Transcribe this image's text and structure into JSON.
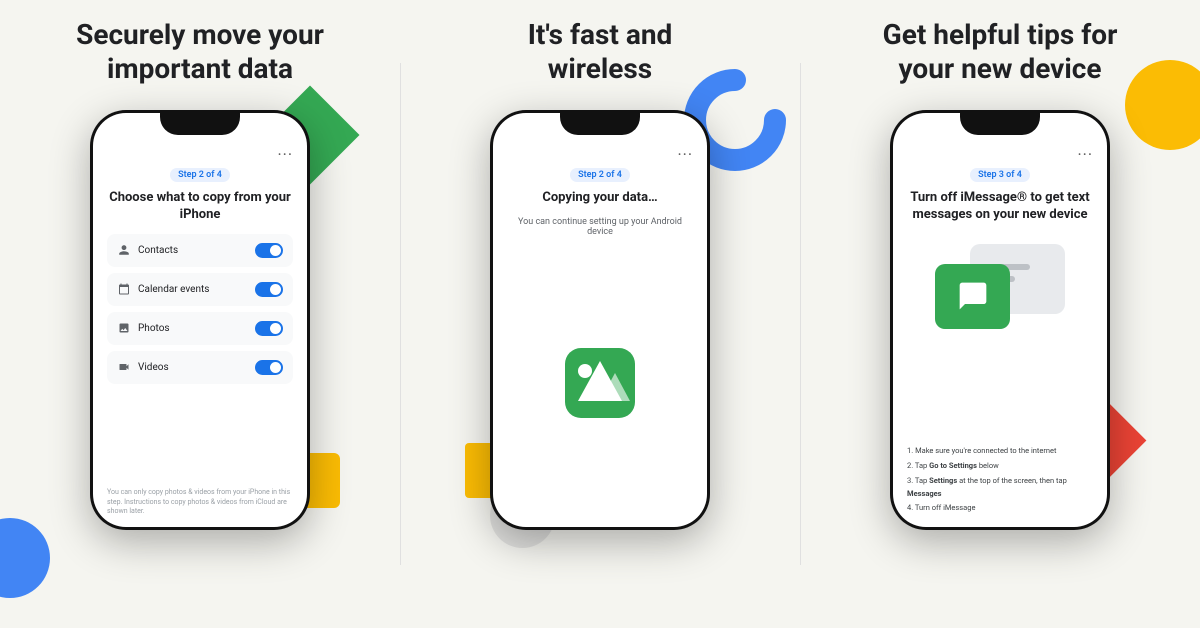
{
  "panels": [
    {
      "id": "panel1",
      "title_line1": "Securely move your",
      "title_line2": "important data",
      "phone": {
        "dots": "···",
        "step_badge": "Step 2 of 4",
        "screen_title": "Choose what to copy from your iPhone",
        "toggles": [
          {
            "icon": "👤",
            "label": "Contacts",
            "on": true
          },
          {
            "icon": "📅",
            "label": "Calendar events",
            "on": true
          },
          {
            "icon": "🖼",
            "label": "Photos",
            "on": true
          },
          {
            "icon": "🎬",
            "label": "Videos",
            "on": true
          }
        ],
        "footnote": "You can only copy photos & videos from your iPhone in this step. Instructions to copy photos & videos from iCloud are shown later."
      }
    },
    {
      "id": "panel2",
      "title_line1": "It's fast and",
      "title_line2": "wireless",
      "phone": {
        "dots": "···",
        "step_badge": "Step 2 of 4",
        "screen_title": "Copying your data…",
        "screen_subtitle": "You can continue setting up your Android device"
      }
    },
    {
      "id": "panel3",
      "title_line1": "Get helpful tips for",
      "title_line2": "your new device",
      "phone": {
        "dots": "···",
        "step_badge": "Step 3 of 4",
        "screen_title": "Turn off iMessage® to get text messages on your new device",
        "steps": [
          "Make sure you're connected to the internet",
          "Tap Go to Settings below",
          "Tap Settings at the top of the screen, then tap Messages",
          "Turn off iMessage"
        ]
      }
    }
  ],
  "colors": {
    "green": "#34A853",
    "blue": "#4285F4",
    "yellow": "#FBBC04",
    "red": "#EA4335"
  }
}
